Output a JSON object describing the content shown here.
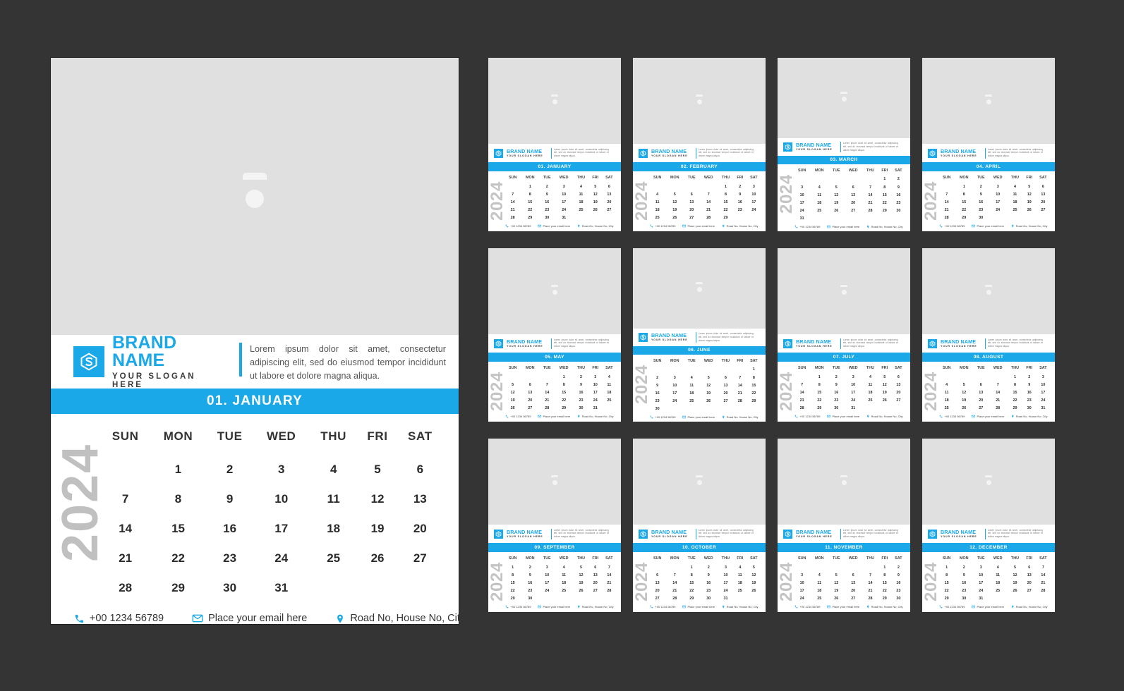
{
  "page": {
    "background_color": "#343434",
    "accent_color": "#1BA8E8",
    "year": "2024",
    "watermark_year": "2024"
  },
  "brand": {
    "name": "BRAND NAME",
    "slogan": "YOUR SLOGAN HERE",
    "logo_icon": "hexagon-monogram-icon",
    "description": "Lorem ipsum dolor sit amet, consectetur adipiscing elit, sed do eiusmod tempor incididunt ut labore et dolore magna aliqua."
  },
  "photo_placeholder": {
    "icon": "camera-icon"
  },
  "contact": {
    "phone": "+00 1234 56789",
    "phone_icon": "phone-icon",
    "email": "Place your email here",
    "email_icon": "envelope-icon",
    "address": "Road No, House No, City",
    "address_icon": "location-pin-icon"
  },
  "weekdays": [
    "SUN",
    "MON",
    "TUE",
    "WED",
    "THU",
    "FRI",
    "SAT"
  ],
  "main_month": {
    "title": "01. JANUARY",
    "number": "01",
    "name": "JANUARY",
    "start_day_index": 1,
    "days_in_month": 31,
    "weeks": [
      [
        "",
        "1",
        "2",
        "3",
        "4",
        "5",
        "6"
      ],
      [
        "7",
        "8",
        "9",
        "10",
        "11",
        "12",
        "13"
      ],
      [
        "14",
        "15",
        "16",
        "17",
        "18",
        "19",
        "20"
      ],
      [
        "21",
        "22",
        "23",
        "24",
        "25",
        "26",
        "27"
      ],
      [
        "28",
        "29",
        "30",
        "31",
        "",
        "",
        ""
      ]
    ]
  },
  "months": [
    {
      "title": "01. JANUARY",
      "number": "01",
      "name": "JANUARY",
      "start_day_index": 1,
      "days_in_month": 31,
      "weeks": [
        [
          "",
          "1",
          "2",
          "3",
          "4",
          "5",
          "6"
        ],
        [
          "7",
          "8",
          "9",
          "10",
          "11",
          "12",
          "13"
        ],
        [
          "14",
          "15",
          "16",
          "17",
          "18",
          "19",
          "20"
        ],
        [
          "21",
          "22",
          "23",
          "24",
          "25",
          "26",
          "27"
        ],
        [
          "28",
          "29",
          "30",
          "31",
          "",
          "",
          ""
        ]
      ]
    },
    {
      "title": "02. FEBRUARY",
      "number": "02",
      "name": "FEBRUARY",
      "start_day_index": 4,
      "days_in_month": 29,
      "weeks": [
        [
          "",
          "",
          "",
          "",
          "1",
          "2",
          "3"
        ],
        [
          "4",
          "5",
          "6",
          "7",
          "8",
          "9",
          "10"
        ],
        [
          "11",
          "12",
          "13",
          "14",
          "15",
          "16",
          "17"
        ],
        [
          "18",
          "19",
          "20",
          "21",
          "22",
          "23",
          "24"
        ],
        [
          "25",
          "26",
          "27",
          "28",
          "29",
          "",
          ""
        ]
      ]
    },
    {
      "title": "03. MARCH",
      "number": "03",
      "name": "MARCH",
      "start_day_index": 5,
      "days_in_month": 31,
      "weeks": [
        [
          "",
          "",
          "",
          "",
          "",
          "1",
          "2"
        ],
        [
          "3",
          "4",
          "5",
          "6",
          "7",
          "8",
          "9"
        ],
        [
          "10",
          "11",
          "12",
          "13",
          "14",
          "15",
          "16"
        ],
        [
          "17",
          "18",
          "19",
          "20",
          "21",
          "22",
          "23"
        ],
        [
          "24",
          "25",
          "26",
          "27",
          "28",
          "29",
          "30"
        ],
        [
          "31",
          "",
          "",
          "",
          "",
          "",
          ""
        ]
      ]
    },
    {
      "title": "04. APRIL",
      "number": "04",
      "name": "APRIL",
      "start_day_index": 1,
      "days_in_month": 30,
      "weeks": [
        [
          "",
          "1",
          "2",
          "3",
          "4",
          "5",
          "6"
        ],
        [
          "7",
          "8",
          "9",
          "10",
          "11",
          "12",
          "13"
        ],
        [
          "14",
          "15",
          "16",
          "17",
          "18",
          "19",
          "20"
        ],
        [
          "21",
          "22",
          "23",
          "24",
          "25",
          "26",
          "27"
        ],
        [
          "28",
          "29",
          "30",
          "",
          "",
          "",
          ""
        ]
      ]
    },
    {
      "title": "05. MAY",
      "number": "05",
      "name": "MAY",
      "start_day_index": 3,
      "days_in_month": 31,
      "weeks": [
        [
          "",
          "",
          "",
          "1",
          "2",
          "3",
          "4"
        ],
        [
          "5",
          "6",
          "7",
          "8",
          "9",
          "10",
          "11"
        ],
        [
          "12",
          "13",
          "14",
          "15",
          "16",
          "17",
          "18"
        ],
        [
          "19",
          "20",
          "21",
          "22",
          "23",
          "24",
          "25"
        ],
        [
          "26",
          "27",
          "28",
          "29",
          "30",
          "31",
          ""
        ]
      ]
    },
    {
      "title": "06. JUNE",
      "number": "06",
      "name": "JUNE",
      "start_day_index": 6,
      "days_in_month": 30,
      "weeks": [
        [
          "",
          "",
          "",
          "",
          "",
          "",
          "1"
        ],
        [
          "2",
          "3",
          "4",
          "5",
          "6",
          "7",
          "8"
        ],
        [
          "9",
          "10",
          "11",
          "12",
          "13",
          "14",
          "15"
        ],
        [
          "16",
          "17",
          "18",
          "19",
          "20",
          "21",
          "22"
        ],
        [
          "23",
          "24",
          "25",
          "26",
          "27",
          "28",
          "29"
        ],
        [
          "30",
          "",
          "",
          "",
          "",
          "",
          ""
        ]
      ]
    },
    {
      "title": "07. JULY",
      "number": "07",
      "name": "JULY",
      "start_day_index": 1,
      "days_in_month": 31,
      "weeks": [
        [
          "",
          "1",
          "2",
          "3",
          "4",
          "5",
          "6"
        ],
        [
          "7",
          "8",
          "9",
          "10",
          "11",
          "12",
          "13"
        ],
        [
          "14",
          "15",
          "16",
          "17",
          "18",
          "19",
          "20"
        ],
        [
          "21",
          "22",
          "23",
          "24",
          "25",
          "26",
          "27"
        ],
        [
          "28",
          "29",
          "30",
          "31",
          "",
          "",
          ""
        ]
      ]
    },
    {
      "title": "08. AUGUST",
      "number": "08",
      "name": "AUGUST",
      "start_day_index": 4,
      "days_in_month": 31,
      "weeks": [
        [
          "",
          "",
          "",
          "",
          "1",
          "2",
          "3"
        ],
        [
          "4",
          "5",
          "6",
          "7",
          "8",
          "9",
          "10"
        ],
        [
          "11",
          "12",
          "13",
          "14",
          "15",
          "16",
          "17"
        ],
        [
          "18",
          "19",
          "20",
          "21",
          "22",
          "23",
          "24"
        ],
        [
          "25",
          "26",
          "27",
          "28",
          "29",
          "30",
          "31"
        ]
      ]
    },
    {
      "title": "09. SEPTEMBER",
      "number": "09",
      "name": "SEPTEMBER",
      "start_day_index": 0,
      "days_in_month": 30,
      "weeks": [
        [
          "1",
          "2",
          "3",
          "4",
          "5",
          "6",
          "7"
        ],
        [
          "8",
          "9",
          "10",
          "11",
          "12",
          "13",
          "14"
        ],
        [
          "15",
          "16",
          "17",
          "18",
          "19",
          "20",
          "21"
        ],
        [
          "22",
          "23",
          "24",
          "25",
          "26",
          "27",
          "28"
        ],
        [
          "29",
          "30",
          "",
          "",
          "",
          "",
          ""
        ]
      ]
    },
    {
      "title": "10. OCTOBER",
      "number": "10",
      "name": "OCTOBER",
      "start_day_index": 2,
      "days_in_month": 31,
      "weeks": [
        [
          "",
          "",
          "1",
          "2",
          "3",
          "4",
          "5"
        ],
        [
          "6",
          "7",
          "8",
          "9",
          "10",
          "11",
          "12"
        ],
        [
          "13",
          "14",
          "15",
          "16",
          "17",
          "18",
          "19"
        ],
        [
          "20",
          "21",
          "22",
          "23",
          "24",
          "25",
          "26"
        ],
        [
          "27",
          "28",
          "29",
          "30",
          "31",
          "",
          ""
        ]
      ]
    },
    {
      "title": "11. NOVEMBER",
      "number": "11",
      "name": "NOVEMBER",
      "start_day_index": 5,
      "days_in_month": 30,
      "weeks": [
        [
          "",
          "",
          "",
          "",
          "",
          "1",
          "2"
        ],
        [
          "3",
          "4",
          "5",
          "6",
          "7",
          "8",
          "9"
        ],
        [
          "10",
          "11",
          "12",
          "13",
          "14",
          "15",
          "16"
        ],
        [
          "17",
          "18",
          "19",
          "20",
          "21",
          "22",
          "23"
        ],
        [
          "24",
          "25",
          "26",
          "27",
          "28",
          "29",
          "30"
        ]
      ]
    },
    {
      "title": "12. DECEMBER",
      "number": "12",
      "name": "DECEMBER",
      "start_day_index": 0,
      "days_in_month": 31,
      "weeks": [
        [
          "1",
          "2",
          "3",
          "4",
          "5",
          "6",
          "7"
        ],
        [
          "8",
          "9",
          "10",
          "11",
          "12",
          "13",
          "14"
        ],
        [
          "15",
          "16",
          "17",
          "18",
          "19",
          "20",
          "21"
        ],
        [
          "22",
          "23",
          "24",
          "25",
          "26",
          "27",
          "28"
        ],
        [
          "29",
          "30",
          "31",
          "",
          "",
          "",
          ""
        ]
      ]
    }
  ]
}
